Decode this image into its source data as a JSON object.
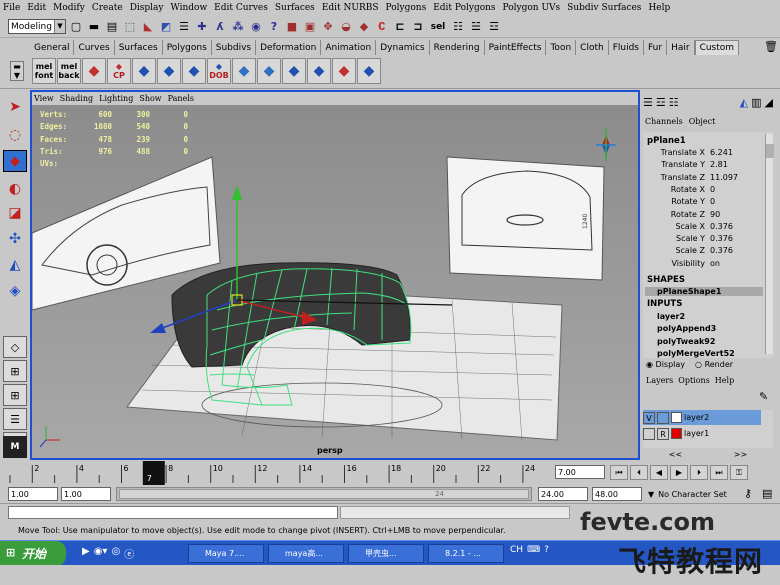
{
  "menubar": {
    "items": [
      "File",
      "Edit",
      "Modify",
      "Create",
      "Display",
      "Window",
      "Edit Curves",
      "Surfaces",
      "Edit NURBS",
      "Polygons",
      "Edit Polygons",
      "Polygon UVs",
      "Subdiv Surfaces",
      "Help"
    ]
  },
  "statusline": {
    "mode": "Modeling",
    "sel_label": "sel"
  },
  "shelf": {
    "tabs": [
      "General",
      "Curves",
      "Surfaces",
      "Polygons",
      "Subdivs",
      "Deformation",
      "Animation",
      "Dynamics",
      "Rendering",
      "PaintEffects",
      "Toon",
      "Cloth",
      "Fluids",
      "Fur",
      "Hair",
      "Custom"
    ],
    "active_tab": "Custom",
    "buttons": [
      {
        "line1": "mel",
        "line2": "font"
      },
      {
        "line1": "mel",
        "line2": "back"
      },
      {
        "line1": "",
        "line2": ""
      },
      {
        "line1": "",
        "line2": "CP"
      },
      {
        "line1": "",
        "line2": ""
      },
      {
        "line1": "",
        "line2": ""
      },
      {
        "line1": "",
        "line2": ""
      },
      {
        "line1": "",
        "line2": "DOB"
      },
      {
        "line1": "",
        "line2": ""
      },
      {
        "line1": "",
        "line2": ""
      },
      {
        "line1": "",
        "line2": ""
      },
      {
        "line1": "",
        "line2": ""
      },
      {
        "line1": "",
        "line2": ""
      },
      {
        "line1": "",
        "line2": ""
      }
    ]
  },
  "viewport": {
    "menu": [
      "View",
      "Shading",
      "Lighting",
      "Show",
      "Panels"
    ],
    "hud": [
      {
        "label": "Verts:",
        "a": "600",
        "b": "300",
        "c": "0"
      },
      {
        "label": "Edges:",
        "a": "1080",
        "b": "540",
        "c": "0"
      },
      {
        "label": "Faces:",
        "a": "478",
        "b": "239",
        "c": "0"
      },
      {
        "label": "Tris:",
        "a": "976",
        "b": "488",
        "c": "0"
      },
      {
        "label": "UVs:",
        "a": "",
        "b": "",
        "c": ""
      }
    ],
    "camera": "persp",
    "ref_dim": "1240"
  },
  "channelbox": {
    "header": [
      "Channels",
      "Object"
    ],
    "object": "pPlane1",
    "attrs": [
      {
        "name": "Translate X",
        "value": "6.241"
      },
      {
        "name": "Translate Y",
        "value": "2.81"
      },
      {
        "name": "Translate Z",
        "value": "11.097"
      },
      {
        "name": "Rotate X",
        "value": "0"
      },
      {
        "name": "Rotate Y",
        "value": "0"
      },
      {
        "name": "Rotate Z",
        "value": "90"
      },
      {
        "name": "Scale X",
        "value": "0.376"
      },
      {
        "name": "Scale Y",
        "value": "0.376"
      },
      {
        "name": "Scale Z",
        "value": "0.376"
      },
      {
        "name": "Visibility",
        "value": "on"
      }
    ],
    "shapes_label": "SHAPES",
    "shape": "pPlaneShape1",
    "inputs_label": "INPUTS",
    "inputs": [
      "layer2",
      "polyAppend3",
      "polyTweak92",
      "polyMergeVert52"
    ]
  },
  "layers": {
    "display": "Display",
    "render": "Render",
    "menu": [
      "Layers",
      "Options",
      "Help"
    ],
    "items": [
      {
        "flag1": "V",
        "flag2": "",
        "name": "layer2",
        "color": "#ffffff"
      },
      {
        "flag1": "",
        "flag2": "R",
        "name": "layer1",
        "color": "#e00000"
      }
    ],
    "nav_left": "<<",
    "nav_right": ">>"
  },
  "timeline": {
    "ticks": [
      "2",
      "4",
      "6",
      "8",
      "10",
      "12",
      "14",
      "16",
      "18",
      "20",
      "22",
      "24"
    ],
    "current": "7",
    "current_field": "7.00"
  },
  "range": {
    "start": "1.00",
    "start2": "1.00",
    "slider_end_label": "24",
    "end": "24.00",
    "end2": "48.00",
    "char_set": "No Character Set"
  },
  "helpline": "Move Tool: Use manipulator to move object(s). Use edit mode to change pivot (INSERT).  Ctrl+LMB to move perpendicular.",
  "taskbar": {
    "start": "开始",
    "tasks": [
      "Maya 7....",
      "maya高...",
      "甲壳虫...",
      "8.2.1 - ..."
    ],
    "tray_lang": "CH"
  },
  "watermark": {
    "line1": "fevte.com",
    "line2": "飞特教程网"
  },
  "colors": {
    "wire": "#40e080",
    "viewport_border": "#2050d0",
    "taskbar": "#2456c4"
  }
}
